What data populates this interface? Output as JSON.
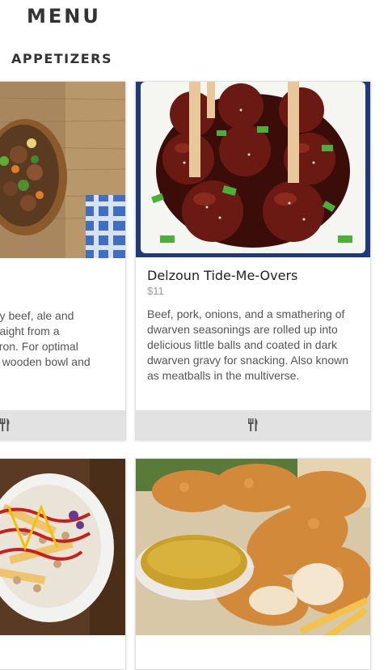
{
  "header": {
    "title": "MENU"
  },
  "section": {
    "title": "APPETIZERS"
  },
  "cards": [
    {
      "name": "",
      "price": "",
      "description_lines": [
        "rty beef, ale and",
        "traight from a",
        "dron. For optimal",
        "a wooden bowl and"
      ],
      "image": "beef-stew-bowl",
      "footer_icon": "utensils-icon"
    },
    {
      "name": "Delzoun Tide-Me-Overs",
      "price": "$11",
      "description": "Beef, pork, onions, and a smathering of dwarven seasonings are rolled up into delicious little balls and coated in dark dwarven gravy for snacking. Also known as meatballs in the multiverse.",
      "image": "glazed-meatballs",
      "footer_icon": "utensils-icon"
    },
    {
      "image": "loaded-fries-plate"
    },
    {
      "image": "chicken-tenders-with-sauce"
    }
  ],
  "colors": {
    "footer_bg": "#e2e2e2",
    "price": "#9a9a9a",
    "text": "#555555"
  }
}
